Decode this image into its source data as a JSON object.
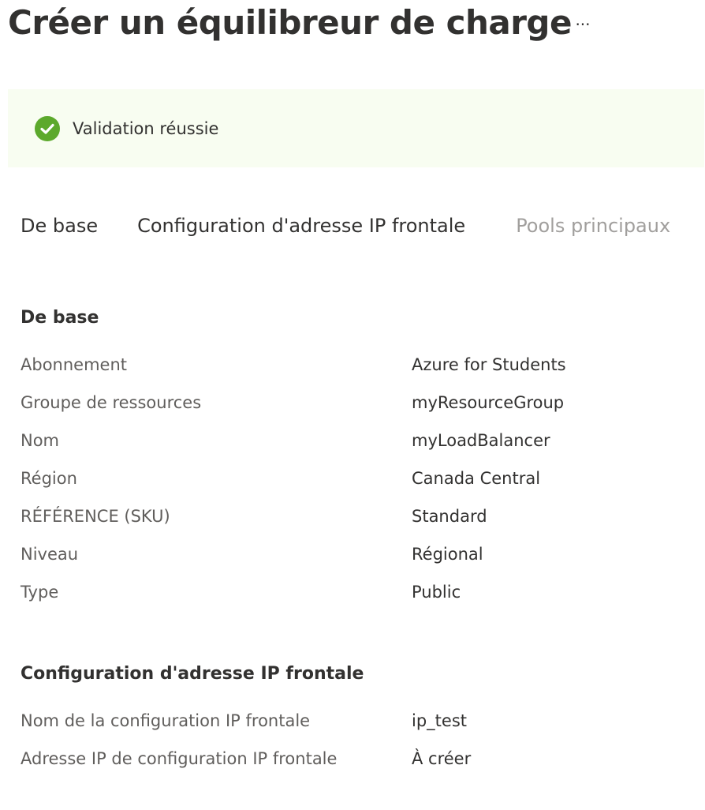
{
  "header": {
    "title": "Créer un équilibreur de charge",
    "more_label": "···"
  },
  "banner": {
    "status": "success",
    "icon": "check-circle-icon",
    "color": "#5ca92c",
    "background": "#f8fdf1",
    "text": "Validation réussie"
  },
  "tabs": [
    {
      "label": "De base",
      "state": "normal"
    },
    {
      "label": "Configuration d'adresse IP frontale",
      "state": "normal"
    },
    {
      "label": "Pools principaux",
      "state": "muted"
    }
  ],
  "sections": [
    {
      "title": "De base",
      "rows": [
        {
          "label": "Abonnement",
          "value": "Azure for Students"
        },
        {
          "label": "Groupe de ressources",
          "value": "myResourceGroup"
        },
        {
          "label": "Nom",
          "value": "myLoadBalancer"
        },
        {
          "label": "Région",
          "value": "Canada Central"
        },
        {
          "label": "RÉFÉRENCE (SKU)",
          "value": "Standard"
        },
        {
          "label": "Niveau",
          "value": "Régional"
        },
        {
          "label": "Type",
          "value": "Public"
        }
      ]
    },
    {
      "title": "Configuration d'adresse IP frontale",
      "rows": [
        {
          "label": "Nom de la configuration IP frontale",
          "value": "ip_test"
        },
        {
          "label": "Adresse IP de configuration IP frontale",
          "value": "À créer"
        }
      ]
    }
  ]
}
